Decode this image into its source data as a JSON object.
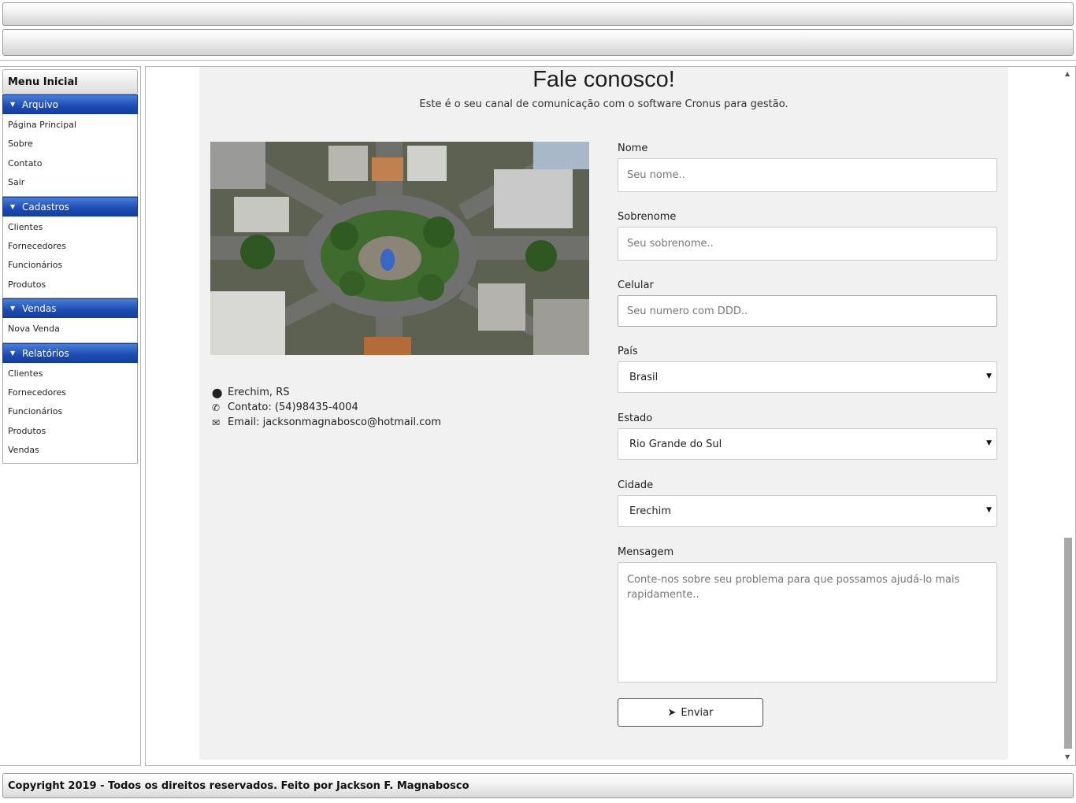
{
  "sidebar": {
    "title": "Menu Inicial",
    "sections": [
      {
        "label": "Arquivo",
        "items": [
          "Página Principal",
          "Sobre",
          "Contato",
          "Sair"
        ]
      },
      {
        "label": "Cadastros",
        "items": [
          "Clientes",
          "Fornecedores",
          "Funcionários",
          "Produtos"
        ]
      },
      {
        "label": "Vendas",
        "items": [
          "Nova Venda"
        ]
      },
      {
        "label": "Relatórios",
        "items": [
          "Clientes",
          "Fornecedores",
          "Funcionários",
          "Produtos",
          "Vendas"
        ]
      }
    ]
  },
  "contact": {
    "title": "Fale conosco!",
    "subtitle": "Este é o seu canal de comunicação com o software Cronus para gestão.",
    "location": "Erechim, RS",
    "phone": "Contato: (54)98435-4004",
    "email": "Email: jacksonmagnabosco@hotmail.com"
  },
  "form": {
    "nome_label": "Nome",
    "nome_placeholder": "Seu nome..",
    "sobrenome_label": "Sobrenome",
    "sobrenome_placeholder": "Seu sobrenome..",
    "celular_label": "Celular",
    "celular_placeholder": "Seu numero com DDD..",
    "pais_label": "País",
    "pais_value": "Brasil",
    "estado_label": "Estado",
    "estado_value": "Rio Grande do Sul",
    "cidade_label": "Cidade",
    "cidade_value": "Erechim",
    "mensagem_label": "Mensagem",
    "mensagem_placeholder": "Conte-nos sobre seu problema para que possamos ajudá-lo mais rapidamente..",
    "submit_label": "Enviar"
  },
  "icons": {
    "location": "map-marker-icon",
    "phone": "phone-icon",
    "email": "envelope-icon",
    "submit": "paper-plane-icon"
  },
  "colors": {
    "menu_category": "#1d4bb4",
    "card_background": "#f1f1f1"
  },
  "footer": {
    "text": "Copyright 2019 - Todos os direitos reservados. Feito por Jackson F. Magnabosco"
  }
}
